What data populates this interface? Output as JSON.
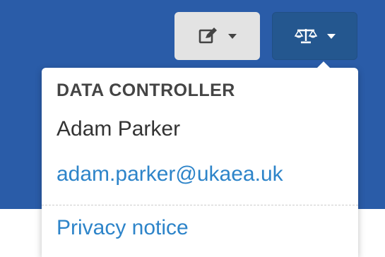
{
  "toolbar": {
    "edit_button": {
      "icon": "edit-icon",
      "color": "#e3e3e3"
    },
    "legal_button": {
      "icon": "scales-icon",
      "color": "#24578f"
    }
  },
  "dropdown": {
    "header": "DATA CONTROLLER",
    "name": "Adam Parker",
    "email": "adam.parker@ukaea.uk",
    "privacy_link": "Privacy notice"
  },
  "colors": {
    "header_bar": "#2a5ca8",
    "link": "#2d84c9",
    "header_text": "#444444"
  }
}
